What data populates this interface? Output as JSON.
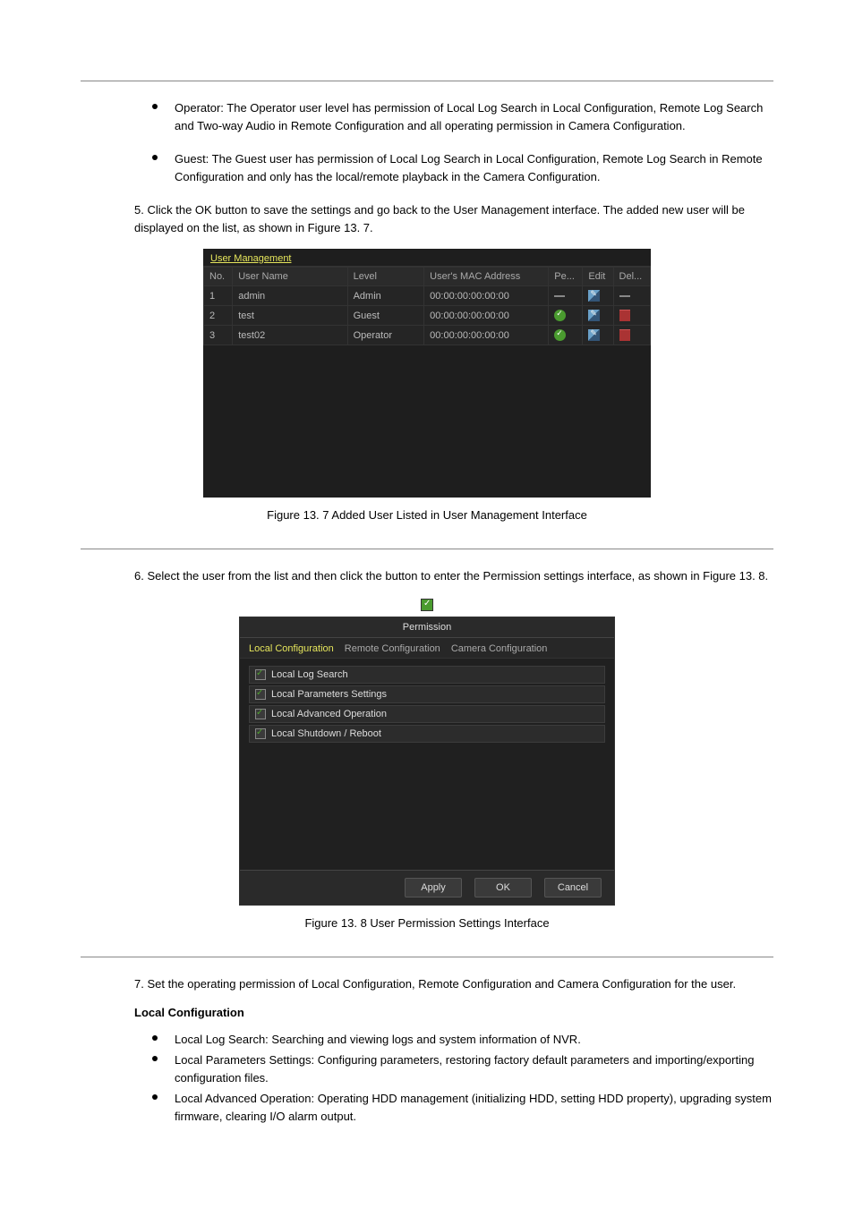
{
  "bullets_top": [
    "Operator: The Operator user level has permission of Local Log Search in Local Configuration, Remote Log Search and Two-way Audio in Remote Configuration and all operating permission in Camera Configuration.",
    "Guest: The Guest user has permission of Local Log Search in Local Configuration, Remote Log Search in Remote Configuration and only has the local/remote playback in the Camera Configuration."
  ],
  "int_para1": "5. Click the OK button to save the settings and go back to the User Management interface. The added new user will be displayed on the list, as shown in Figure 13. 7.",
  "int_para2": "6. Select the user from the list and then click the      button to enter the Permission settings interface, as shown in Figure 13. 8.",
  "int_para3": "7. Set the operating permission of Local Configuration, Remote Configuration and Camera Configuration for the user.",
  "fig1_caption": "Figure 13. 7 Added User Listed in User Management Interface",
  "fig2_caption": "Figure 13. 8 User Permission Settings Interface",
  "um": {
    "title": "User Management",
    "headers": {
      "no": "No.",
      "user": "User Name",
      "level": "Level",
      "mac": "User's MAC Address",
      "pe": "Pe...",
      "edit": "Edit",
      "del": "Del..."
    },
    "rows": [
      {
        "no": "1",
        "user": "admin",
        "level": "Admin",
        "mac": "00:00:00:00:00:00",
        "pe": "dash",
        "del": "dash"
      },
      {
        "no": "2",
        "user": "test",
        "level": "Guest",
        "mac": "00:00:00:00:00:00",
        "pe": "check",
        "del": "trash"
      },
      {
        "no": "3",
        "user": "test02",
        "level": "Operator",
        "mac": "00:00:00:00:00:00",
        "pe": "check",
        "del": "trash"
      }
    ]
  },
  "perm": {
    "title": "Permission",
    "tabs": {
      "local": "Local Configuration",
      "remote": "Remote Configuration",
      "camera": "Camera Configuration"
    },
    "items": [
      "Local Log Search",
      "Local Parameters Settings",
      "Local Advanced Operation",
      "Local Shutdown / Reboot"
    ],
    "buttons": {
      "apply": "Apply",
      "ok": "OK",
      "cancel": "Cancel"
    }
  },
  "local_section": {
    "heading": "Local Configuration",
    "bullets": [
      "Local Log Search: Searching and viewing logs and system information of NVR.",
      "Local Parameters Settings: Configuring parameters, restoring factory default parameters and importing/exporting configuration files.",
      "Local Advanced Operation: Operating HDD management (initializing HDD, setting HDD property), upgrading system firmware, clearing I/O alarm output."
    ]
  }
}
